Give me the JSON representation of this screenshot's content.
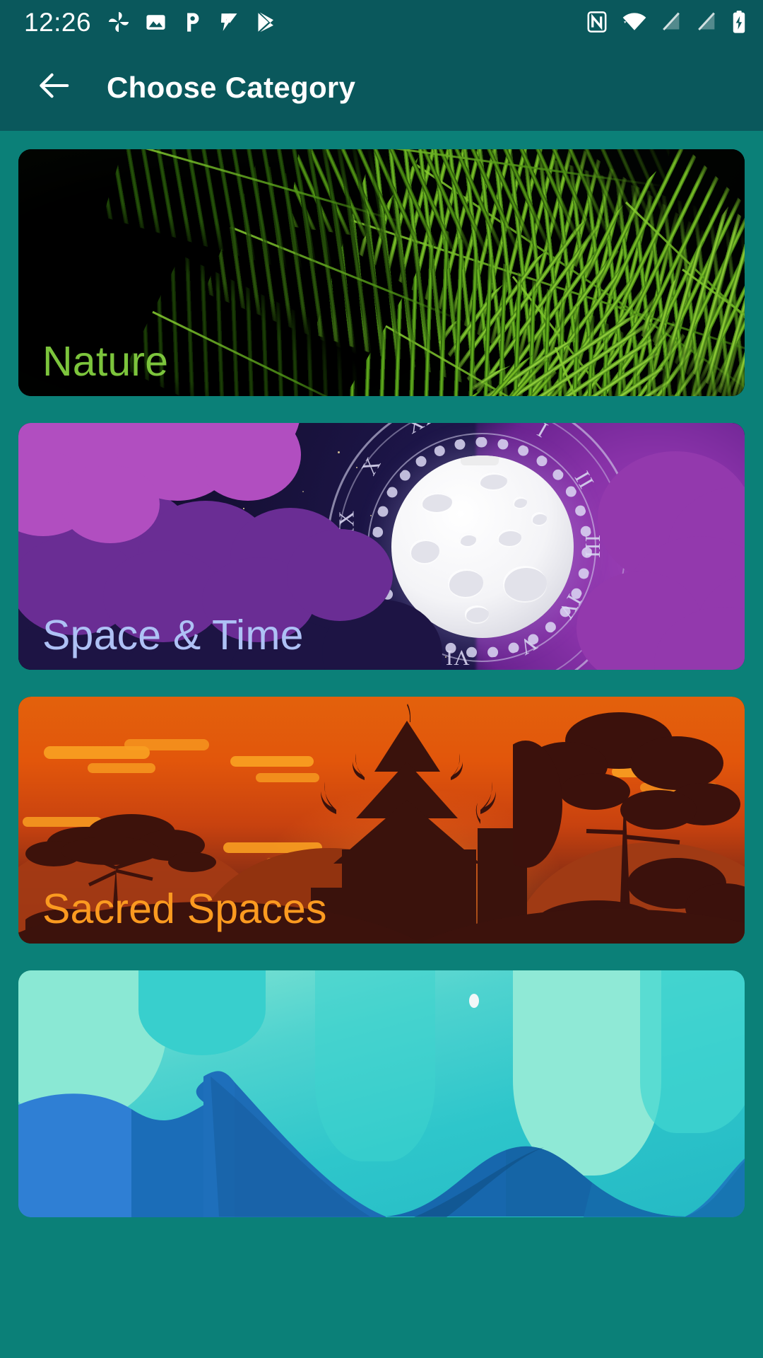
{
  "status_bar": {
    "time": "12:26",
    "left_icons": [
      "pinwheel-icon",
      "photo-icon",
      "letter-p-icon",
      "checkmark-flag-icon",
      "play-store-icon"
    ],
    "right_icons": [
      "nfc-icon",
      "wifi-icon",
      "no-signal-icon",
      "no-signal-icon",
      "battery-charging-icon"
    ]
  },
  "app_bar": {
    "back_label": "Back",
    "title": "Choose Category"
  },
  "theme": {
    "appbar_bg": "#0a585c",
    "page_bg": "#0b8078",
    "title_color": "#ffffff"
  },
  "categories": [
    {
      "name": "Nature",
      "label_color": "#7cc43c",
      "art": "palm-fronds-dark-green"
    },
    {
      "name": "Space & Time",
      "label_color": "#aec1f5",
      "art": "moon-clock-planet-night-sky"
    },
    {
      "name": "Sacred Spaces",
      "label_color": "#fb9a20",
      "art": "temple-silhouette-orange-sunset"
    },
    {
      "name": "",
      "label_color": "#ffffff",
      "art": "blue-mountains-teal-sky"
    }
  ]
}
